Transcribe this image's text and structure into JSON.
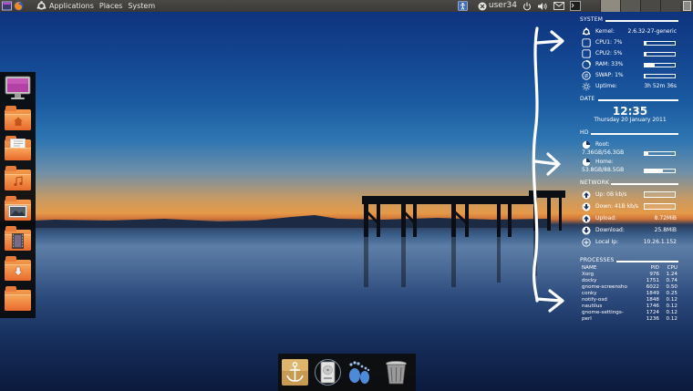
{
  "top_panel": {
    "menus": [
      "Applications",
      "Places",
      "System"
    ],
    "user": "user34"
  },
  "conky": {
    "system": {
      "heading": "SYSTEM",
      "kernel_label": "Kernel:",
      "kernel_value": "2.6.32-27-generic",
      "cpu1_label": "CPU1: 7%",
      "cpu1_fraction": 0.07,
      "cpu2_label": "CPU2: 5%",
      "cpu2_fraction": 0.05,
      "ram_label": "RAM: 33%",
      "ram_fraction": 0.33,
      "swap_label": "SWAP: 1%",
      "swap_fraction": 0.01,
      "uptime_label": "Uptime:",
      "uptime_value": "3h 52m 36s"
    },
    "date": {
      "heading": "DATE",
      "time": "12:35",
      "date": "Thursday 20 January 2011"
    },
    "hd": {
      "heading": "HD",
      "root_label": "Root:",
      "root_value": "7.36GB/56.3GB",
      "root_fraction": 0.13,
      "home_label": "Home:",
      "home_value": "53.8GB/88.5GB",
      "home_fraction": 0.61
    },
    "network": {
      "heading": "NETWORK",
      "up_label": "Up: 0B  kb/s",
      "down_label": "Down: 41B  kb/s",
      "upload_label": "Upload:",
      "upload_value": "8.72MiB",
      "download_label": "Download:",
      "download_value": "25.8MiB",
      "local_ip_label": "Local Ip:",
      "local_ip_value": "10.26.1.152"
    },
    "processes": {
      "heading": "PROCESSES",
      "col_name": "NAME",
      "col_pid": "PID",
      "col_cpu": "CPU",
      "rows": [
        {
          "name": "Xorg",
          "pid": "976",
          "cpu": "1.24"
        },
        {
          "name": "docky",
          "pid": "1751",
          "cpu": "0.74"
        },
        {
          "name": "gnome-screensho",
          "pid": "6022",
          "cpu": "0.50"
        },
        {
          "name": "conky",
          "pid": "1849",
          "cpu": "0.25"
        },
        {
          "name": "notify-osd",
          "pid": "1848",
          "cpu": "0.12"
        },
        {
          "name": "nautilus",
          "pid": "1746",
          "cpu": "0.12"
        },
        {
          "name": "gnome-settings-",
          "pid": "1724",
          "cpu": "0.12"
        },
        {
          "name": "perl",
          "pid": "1236",
          "cpu": "0.12"
        }
      ]
    }
  },
  "left_dock": [
    "monitor-icon",
    "home-folder-icon",
    "documents-folder-icon",
    "music-folder-icon",
    "pictures-folder-icon",
    "videos-folder-icon",
    "downloads-folder-icon",
    "folder-icon"
  ],
  "bottom_dock": [
    "docky-anchor-icon",
    "hard-disk-icon",
    "gnome-foot-icon",
    "trash-icon"
  ],
  "colors": {
    "panel_bg": "#3d3c38",
    "folder_orange": "#e8692b",
    "conky_text": "#ffffff",
    "dock_bg": "#111111"
  }
}
